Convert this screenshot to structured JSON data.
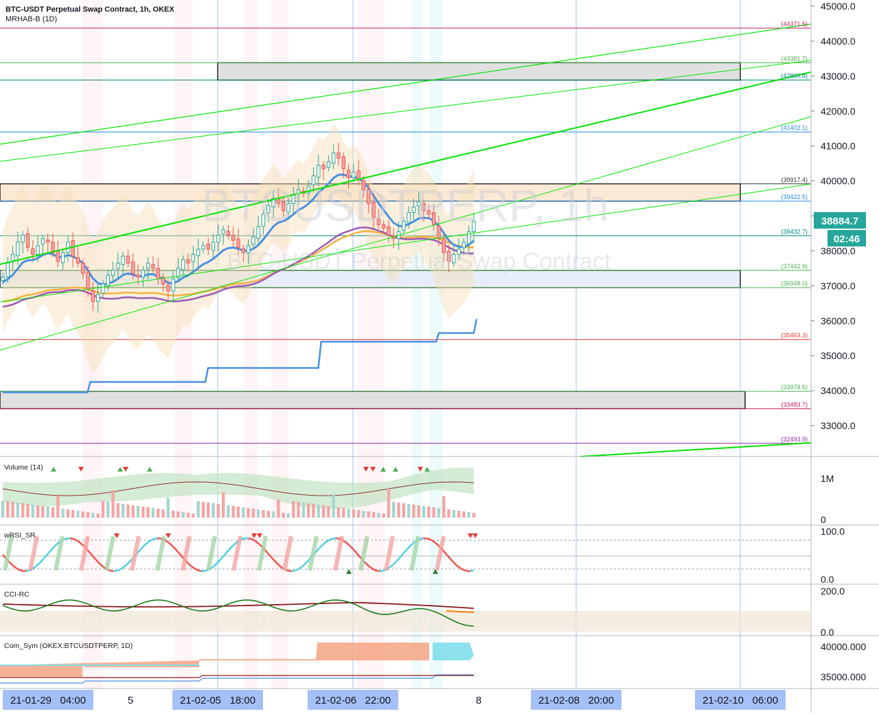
{
  "header": {
    "symbol_line": "BTC-USDT Perpetual Swap Contract, 1h, OKEX",
    "indicator_line": "MRHAB-B (1D)"
  },
  "watermark": {
    "big": "BTCUSDTPERP, 1h",
    "sub": "BTC-USDT Perpetual Swap Contract"
  },
  "colors": {
    "up": "#26a69a",
    "down": "#ef5350",
    "grid": "#e0e3eb",
    "axis_text": "#131722",
    "ema_blue": "#4a90e2",
    "ema_orange": "#f5b041",
    "ema_purple": "#9c59b6",
    "line_green": "#00e400",
    "line_blue": "#2962ff",
    "accent_teal": "#26a69a"
  },
  "chart_data": [
    {
      "type": "line",
      "name": "price-pane",
      "title": "BTC-USDT Perpetual Swap Contract, 1h, OKEX",
      "ylim": [
        32200,
        45200
      ],
      "y_ticks": [
        "45000.0",
        "44000.0",
        "43000.0",
        "42000.0",
        "41000.0",
        "40000.0",
        "39000.0",
        "38000.0",
        "37000.0",
        "36000.0",
        "35000.0",
        "34000.0",
        "33000.0"
      ],
      "y_tick_values": [
        45000,
        44000,
        43000,
        42000,
        41000,
        40000,
        39000,
        38000,
        37000,
        36000,
        35000,
        34000,
        33000
      ],
      "last_price": "38884.7",
      "countdown": "02:46",
      "levels": [
        {
          "label": "(44371.5)",
          "value": 44371.5,
          "color": "#c2185b"
        },
        {
          "label": "(43381.7)",
          "value": 43381.7,
          "color": "#4caf50"
        },
        {
          "label": "(42886.8)",
          "value": 42886.8,
          "color": "#00897b"
        },
        {
          "label": "(41402.1)",
          "value": 41402.1,
          "color": "#1e88e5"
        },
        {
          "label": "(39917.4)",
          "value": 39917.4,
          "color": "#333333"
        },
        {
          "label": "(39422.5)",
          "value": 39422.5,
          "color": "#1e88e5"
        },
        {
          "label": "(38432.7)",
          "value": 38432.7,
          "color": "#00897b"
        },
        {
          "label": "(37442.9)",
          "value": 37442.9,
          "color": "#4caf50"
        },
        {
          "label": "(36948.0)",
          "value": 36948.0,
          "color": "#4caf50"
        },
        {
          "label": "(35463.3)",
          "value": 35463.3,
          "color": "#e53935"
        },
        {
          "label": "(33978.6)",
          "value": 33978.6,
          "color": "#4caf50"
        },
        {
          "label": "(33483.7)",
          "value": 33483.7,
          "color": "#c2185b"
        },
        {
          "label": "(32493.9)",
          "value": 32493.9,
          "color": "#8e24aa"
        }
      ],
      "candles_close": [
        37250,
        37650,
        37900,
        38250,
        38450,
        38100,
        37900,
        38150,
        38350,
        38250,
        37950,
        37700,
        37950,
        38250,
        37850,
        37650,
        37350,
        36900,
        36550,
        36750,
        37050,
        37300,
        37450,
        37650,
        37850,
        37650,
        37350,
        37250,
        37450,
        37650,
        37500,
        37200,
        37050,
        36850,
        37200,
        37500,
        37750,
        37650,
        37900,
        38050,
        38150,
        38050,
        38250,
        38450,
        38600,
        38450,
        38300,
        38100,
        37950,
        38150,
        38400,
        38700,
        39050,
        39300,
        39500,
        39350,
        39150,
        39350,
        39600,
        39750,
        39650,
        39850,
        40150,
        40450,
        40350,
        40550,
        40800,
        40650,
        40350,
        40100,
        40250,
        40050,
        39750,
        39350,
        38950,
        38750,
        38650,
        38450,
        38350,
        38550,
        38850,
        39100,
        39250,
        39400,
        39150,
        39050,
        38750,
        38350,
        37950,
        37700,
        37900,
        38050,
        38250,
        38550,
        38850
      ],
      "stepped_line": [
        {
          "x": 0,
          "value": 33950
        },
        {
          "x": 18,
          "value": 34250
        },
        {
          "x": 43,
          "value": 34650
        },
        {
          "x": 67,
          "value": 35400
        },
        {
          "x": 92,
          "value": 35650
        },
        {
          "x": 100,
          "value": 36050
        }
      ]
    },
    {
      "type": "bar",
      "name": "volume-pane",
      "title": "Volume (14)",
      "y_ticks": [
        "1M",
        "0"
      ],
      "y_tick_values": [
        1000000,
        0
      ]
    },
    {
      "type": "line",
      "name": "wrsi-pane",
      "title": "wRSI_SR",
      "y_ticks": [
        "100.0",
        "0.0"
      ],
      "y_tick_values": [
        100,
        0
      ]
    },
    {
      "type": "line",
      "name": "cci-pane",
      "title": "CCI-RC",
      "y_ticks": [
        "200.0",
        "0.0"
      ],
      "y_tick_values": [
        200,
        0
      ]
    },
    {
      "type": "area",
      "name": "comsym-pane",
      "title": "Com_Sym (OKEX:BTCUSDTPERP, 1D)",
      "y_ticks": [
        "40000.000",
        "35000.000"
      ],
      "y_tick_values": [
        40000,
        35000
      ]
    }
  ],
  "time_axis": {
    "labels": [
      {
        "text": "21-01-29   04:00",
        "highlight": true
      },
      {
        "text": "5",
        "highlight": false
      },
      {
        "text": "21-02-05   18:00",
        "highlight": true
      },
      {
        "text": "21-02-06   22:00",
        "highlight": true
      },
      {
        "text": "8",
        "highlight": false
      },
      {
        "text": "21-02-08   20:00",
        "highlight": true
      },
      {
        "text": "21-02-10   06:00",
        "highlight": true
      }
    ]
  }
}
